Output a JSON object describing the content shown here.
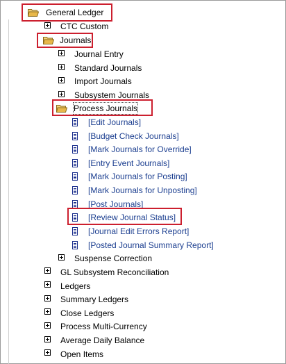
{
  "tree": {
    "root": {
      "label": "General Ledger",
      "icon": "open-folder-icon"
    },
    "items": [
      {
        "label": "CTC Custom"
      },
      {
        "label": "Journals",
        "icon": "open-folder-icon"
      },
      {
        "label": "Journal Entry"
      },
      {
        "label": "Standard Journals"
      },
      {
        "label": "Import Journals"
      },
      {
        "label": "Subsystem Journals"
      },
      {
        "label": "Process Journals",
        "icon": "open-folder-icon"
      },
      {
        "label": "[Edit Journals]"
      },
      {
        "label": "[Budget Check Journals]"
      },
      {
        "label": "[Mark Journals for Override]"
      },
      {
        "label": "[Entry Event Journals]"
      },
      {
        "label": "[Mark Journals for Posting]"
      },
      {
        "label": "[Mark Journals for Unposting]"
      },
      {
        "label": "[Post Journals]"
      },
      {
        "label": "[Review Journal Status]"
      },
      {
        "label": "[Journal Edit Errors Report]"
      },
      {
        "label": "[Posted Journal Summary Report]"
      },
      {
        "label": "Suspense Correction"
      },
      {
        "label": "GL Subsystem Reconciliation"
      },
      {
        "label": "Ledgers"
      },
      {
        "label": "Summary Ledgers"
      },
      {
        "label": "Close Ledgers"
      },
      {
        "label": "Process Multi-Currency"
      },
      {
        "label": "Average Daily Balance"
      },
      {
        "label": "Open Items"
      }
    ]
  },
  "colors": {
    "highlight": "#cc1f2e",
    "link": "#1a3d8f",
    "doc_icon": "#1a2e8c",
    "folder": "#e8b84a"
  }
}
